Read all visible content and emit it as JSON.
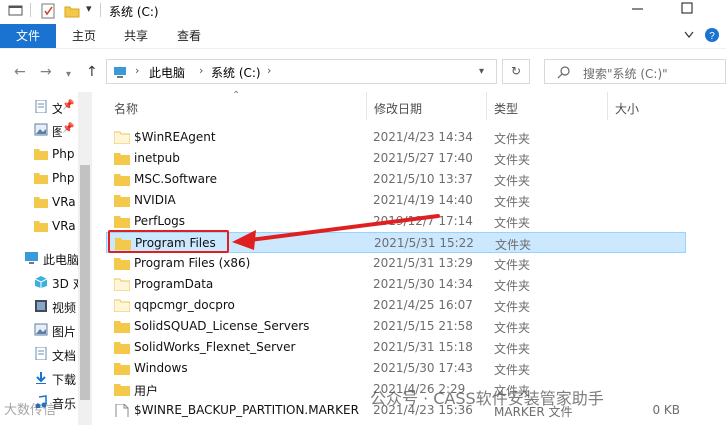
{
  "title_bar": {
    "title": "系统 (C:)",
    "minimize_icon": "minimize-icon",
    "maximize_icon": "maximize-icon"
  },
  "ribbon": {
    "tabs": [
      "文件",
      "主页",
      "共享",
      "查看"
    ]
  },
  "address": {
    "segments": [
      "此电脑",
      "系统 (C:)"
    ],
    "search_placeholder": "搜索\"系统 (C:)\""
  },
  "nav_pane": {
    "items": [
      {
        "label": "文",
        "icon": "document-icon"
      },
      {
        "label": "图",
        "icon": "picture-icon"
      },
      {
        "label": "Php",
        "icon": "folder-icon"
      },
      {
        "label": "Php",
        "icon": "folder-icon"
      },
      {
        "label": "VRa",
        "icon": "folder-icon"
      },
      {
        "label": "VRa",
        "icon": "folder-icon"
      },
      {
        "label": "此电脑",
        "icon": "computer-icon"
      },
      {
        "label": "3D 对",
        "icon": "3d-objects-icon"
      },
      {
        "label": "视频",
        "icon": "video-icon"
      },
      {
        "label": "图片",
        "icon": "picture-icon"
      },
      {
        "label": "文档",
        "icon": "document-icon"
      },
      {
        "label": "下载",
        "icon": "download-icon"
      },
      {
        "label": "音乐",
        "icon": "music-icon"
      }
    ]
  },
  "columns": {
    "name": "名称",
    "modified": "修改日期",
    "type": "类型",
    "size": "大小"
  },
  "files": [
    {
      "name": "$WinREAgent",
      "date": "2021/4/23 14:34",
      "type": "文件夹",
      "size": "",
      "icon": "folder-icon"
    },
    {
      "name": "inetpub",
      "date": "2021/5/27 17:40",
      "type": "文件夹",
      "size": "",
      "icon": "folder-icon"
    },
    {
      "name": "MSC.Software",
      "date": "2021/5/10 13:37",
      "type": "文件夹",
      "size": "",
      "icon": "folder-icon"
    },
    {
      "name": "NVIDIA",
      "date": "2021/4/19 14:40",
      "type": "文件夹",
      "size": "",
      "icon": "folder-icon"
    },
    {
      "name": "PerfLogs",
      "date": "2019/12/7 17:14",
      "type": "文件夹",
      "size": "",
      "icon": "folder-icon"
    },
    {
      "name": "Program Files",
      "date": "2021/5/31 15:22",
      "type": "文件夹",
      "size": "",
      "icon": "folder-icon",
      "selected": true
    },
    {
      "name": "Program Files (x86)",
      "date": "2021/5/31 13:29",
      "type": "文件夹",
      "size": "",
      "icon": "folder-icon"
    },
    {
      "name": "ProgramData",
      "date": "2021/5/30 14:34",
      "type": "文件夹",
      "size": "",
      "icon": "folder-icon"
    },
    {
      "name": "qqpcmgr_docpro",
      "date": "2021/4/25 16:07",
      "type": "文件夹",
      "size": "",
      "icon": "folder-icon"
    },
    {
      "name": "SolidSQUAD_License_Servers",
      "date": "2021/5/15 21:58",
      "type": "文件夹",
      "size": "",
      "icon": "folder-icon"
    },
    {
      "name": "SolidWorks_Flexnet_Server",
      "date": "2021/5/31 15:18",
      "type": "文件夹",
      "size": "",
      "icon": "folder-icon"
    },
    {
      "name": "Windows",
      "date": "2021/5/30 17:43",
      "type": "文件夹",
      "size": "",
      "icon": "folder-icon"
    },
    {
      "name": "用户",
      "date": "2021/4/26 2:29",
      "type": "文件夹",
      "size": "",
      "icon": "folder-icon"
    },
    {
      "name": "$WINRE_BACKUP_PARTITION.MARKER",
      "date": "2021/4/23 15:36",
      "type": "MARKER 文件",
      "size": "0 KB",
      "icon": "file-icon"
    }
  ],
  "watermark": {
    "left": "大数传信",
    "right": "公众号 · CASS软件安装管家助手"
  },
  "colors": {
    "accent": "#1a73d1",
    "selection": "#cce8ff",
    "highlight_box": "#e02020",
    "folder": "#f4c84a"
  }
}
